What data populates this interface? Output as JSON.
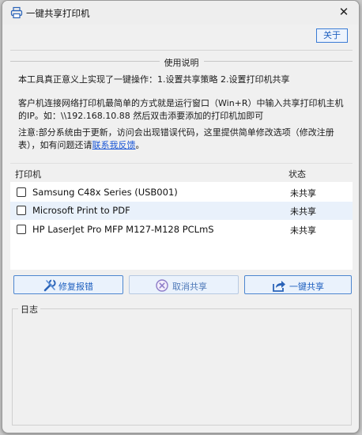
{
  "window": {
    "title": "一键共享打印机",
    "close_glyph": "✕"
  },
  "header": {
    "about_label": "关于"
  },
  "usage": {
    "title": "使用说明",
    "line1": "本工具真正意义上实现了一键操作：1.设置共享策略 2.设置打印机共享",
    "line2": "客户机连接网络打印机最简单的方式就是运行窗口（Win+R）中输入共享打印机主机的IP。如：\\\\192.168.10.88 然后双击添要添加的打印机加即可",
    "line3_prefix": "注意:部分系统由于更新，访问会出现错误代码，这里提供简单修改选项（修改注册表），如有问题还请",
    "line3_link": "联系我反馈",
    "line3_suffix": "。"
  },
  "printers": {
    "col_name": "打印机",
    "col_status": "状态",
    "rows": [
      {
        "name": "Samsung C48x Series (USB001)",
        "status": "未共享"
      },
      {
        "name": "Microsoft Print to PDF",
        "status": "未共享"
      },
      {
        "name": "HP LaserJet Pro MFP M127-M128 PCLmS",
        "status": "未共享"
      }
    ]
  },
  "actions": {
    "repair_label": "修复报错",
    "cancel_label": "取消共享",
    "share_label": "一键共享"
  },
  "log": {
    "title": "日志"
  },
  "colors": {
    "accent": "#3a7bd5",
    "selected_row": "#e9f1fb"
  },
  "icons": {
    "title": "printer-icon",
    "repair": "wrench-icon",
    "cancel": "cancel-circle-icon",
    "share": "share-icon"
  }
}
